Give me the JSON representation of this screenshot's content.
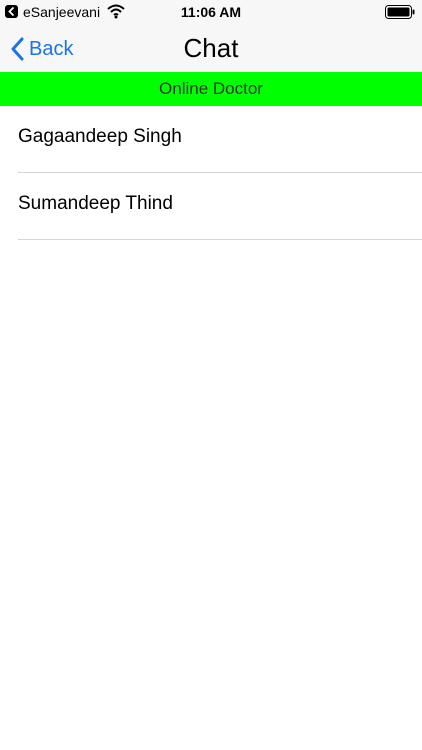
{
  "status_bar": {
    "back_app": "eSanjeevani",
    "time": "11:06 AM"
  },
  "nav": {
    "back_label": "Back",
    "title": "Chat"
  },
  "banner": {
    "label": "Online Doctor",
    "color": "#00ff00"
  },
  "doctors": [
    {
      "name": "Gagaandeep Singh"
    },
    {
      "name": "Sumandeep Thind"
    }
  ],
  "colors": {
    "accent": "#1a73e8"
  }
}
